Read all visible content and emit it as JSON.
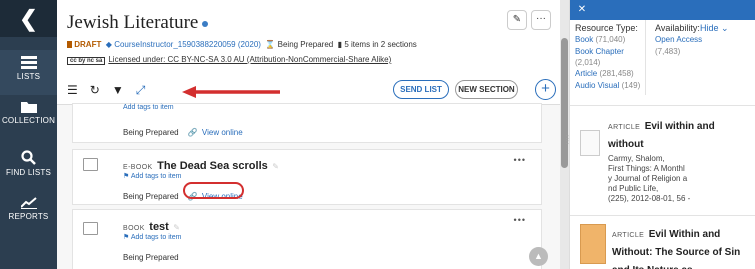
{
  "nav": {
    "back_icon": "chevron-left-icon",
    "items": [
      {
        "label": "LISTS",
        "icon": "list-icon",
        "active": true
      },
      {
        "label": "COLLECTION",
        "icon": "folder-icon",
        "active": false
      },
      {
        "label": "FIND LISTS",
        "icon": "search-icon",
        "active": false
      },
      {
        "label": "REPORTS",
        "icon": "chart-icon",
        "active": false
      }
    ]
  },
  "header": {
    "title": "Jewish Literature",
    "status": "DRAFT",
    "course": "CourseInstructor_1590388220059 (2020)",
    "state": "Being Prepared",
    "items_count": "5 items in 2 sections",
    "license_badge": "cc by nc sa",
    "license": "Licensed under: CC BY-NC-SA 3.0 AU (Attribution-NonCommercial-Share Alike)",
    "edit_icon": "pencil-icon",
    "more_icon": "more-horizontal-icon"
  },
  "toolbar": {
    "icons": [
      "list-view-icon",
      "refresh-icon",
      "filter-icon",
      "expand-icon"
    ],
    "send_list": "SEND LIST",
    "new_section": "NEW SECTION",
    "add": "+"
  },
  "list": {
    "partial_item": {
      "tags": "Add tags to item",
      "status": "Being Prepared",
      "view_online": "View online"
    },
    "items": [
      {
        "type": "E-BOOK",
        "title": "The Dead Sea scrolls",
        "tags": "Add tags to item",
        "status": "Being Prepared",
        "view_online": "View online"
      },
      {
        "type": "BOOK",
        "title": "test",
        "tags": "Add tags to item",
        "status": "Being Prepared"
      }
    ],
    "more": "•••"
  },
  "rightpanel": {
    "close": "✕",
    "resource_type_head": "Resource Type:",
    "availability_head": "Availability:",
    "hide": "Hide ⌄",
    "resource_types": [
      {
        "label": "Book",
        "count": "(71,040)"
      },
      {
        "label": "Book Chapter",
        "count": "(2,014)"
      },
      {
        "label": "Article",
        "count": "(281,458)"
      },
      {
        "label": "Audio Visual",
        "count": "(149)"
      }
    ],
    "availability": [
      {
        "label": "Open Access",
        "count": "(7,483)"
      }
    ],
    "results": [
      {
        "type": "ARTICLE",
        "title": "Evil within and without",
        "detail": [
          "Carmy, Shalom,",
          "First Things: A Monthl",
          "y Journal of Religion a",
          "nd Public Life,",
          "(225), 2012-08-01, 56 -"
        ]
      },
      {
        "type": "ARTICLE",
        "title": "Evil Within and Without: The Source of Sin and Its Nature as",
        "detail": []
      }
    ]
  },
  "colors": {
    "nav_bg": "#2c3e50",
    "accent": "#2a6ebb",
    "highlight": "#d32f2f"
  }
}
